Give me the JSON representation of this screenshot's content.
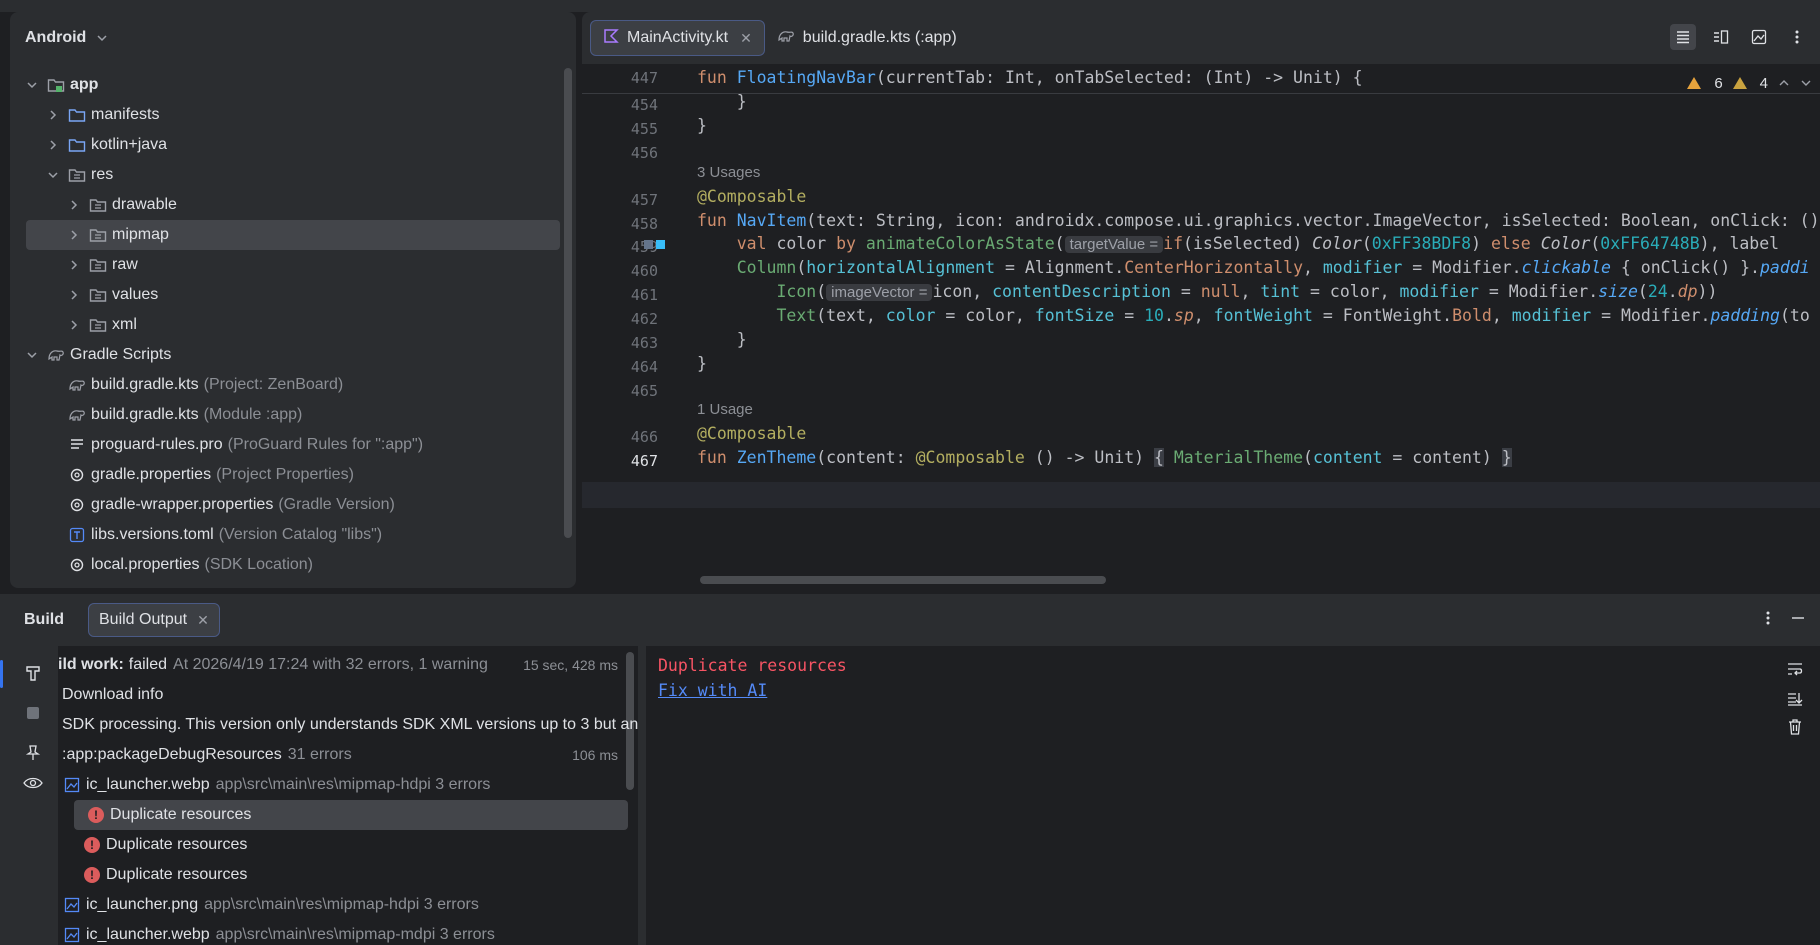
{
  "project": {
    "title": "Android",
    "tree": [
      {
        "label": "app",
        "hint": "",
        "level": 0,
        "toggle": "expanded",
        "icon": "module-folder-icon",
        "bold": true,
        "selected": false
      },
      {
        "label": "manifests",
        "hint": "",
        "level": 1,
        "toggle": "collapsed",
        "icon": "folder-icon",
        "bold": false,
        "selected": false
      },
      {
        "label": "kotlin+java",
        "hint": "",
        "level": 1,
        "toggle": "collapsed",
        "icon": "folder-icon",
        "bold": false,
        "selected": false
      },
      {
        "label": "res",
        "hint": "",
        "level": 1,
        "toggle": "expanded",
        "icon": "resource-folder-icon",
        "bold": false,
        "selected": false
      },
      {
        "label": "drawable",
        "hint": "",
        "level": 2,
        "toggle": "collapsed",
        "icon": "resource-folder-icon",
        "bold": false,
        "selected": false
      },
      {
        "label": "mipmap",
        "hint": "",
        "level": 2,
        "toggle": "collapsed",
        "icon": "resource-folder-icon",
        "bold": false,
        "selected": true
      },
      {
        "label": "raw",
        "hint": "",
        "level": 2,
        "toggle": "collapsed",
        "icon": "resource-folder-icon",
        "bold": false,
        "selected": false
      },
      {
        "label": "values",
        "hint": "",
        "level": 2,
        "toggle": "collapsed",
        "icon": "resource-folder-icon",
        "bold": false,
        "selected": false
      },
      {
        "label": "xml",
        "hint": "",
        "level": 2,
        "toggle": "collapsed",
        "icon": "resource-folder-icon",
        "bold": false,
        "selected": false
      },
      {
        "label": "Gradle Scripts",
        "hint": "",
        "level": 0,
        "toggle": "expanded",
        "icon": "gradle-icon",
        "bold": false,
        "selected": false
      },
      {
        "label": "build.gradle.kts",
        "hint": "(Project: ZenBoard)",
        "level": 1,
        "toggle": "none",
        "icon": "gradle-icon",
        "bold": false,
        "selected": false
      },
      {
        "label": "build.gradle.kts",
        "hint": "(Module :app)",
        "level": 1,
        "toggle": "none",
        "icon": "gradle-icon",
        "bold": false,
        "selected": false
      },
      {
        "label": "proguard-rules.pro",
        "hint": "(ProGuard Rules for \":app\")",
        "level": 1,
        "toggle": "none",
        "icon": "text-file-icon",
        "bold": false,
        "selected": false
      },
      {
        "label": "gradle.properties",
        "hint": "(Project Properties)",
        "level": 1,
        "toggle": "none",
        "icon": "settings-file-icon",
        "bold": false,
        "selected": false
      },
      {
        "label": "gradle-wrapper.properties",
        "hint": "(Gradle Version)",
        "level": 1,
        "toggle": "none",
        "icon": "settings-file-icon",
        "bold": false,
        "selected": false
      },
      {
        "label": "libs.versions.toml",
        "hint": "(Version Catalog \"libs\")",
        "level": 1,
        "toggle": "none",
        "icon": "toml-file-icon",
        "bold": false,
        "selected": false
      },
      {
        "label": "local.properties",
        "hint": "(SDK Location)",
        "level": 1,
        "toggle": "none",
        "icon": "settings-file-icon",
        "bold": false,
        "selected": false
      }
    ]
  },
  "editor": {
    "tabs": [
      {
        "label": "MainActivity.kt",
        "active": true,
        "closable": true,
        "icon": "kotlin-file-icon"
      },
      {
        "label": "build.gradle.kts (:app)",
        "active": false,
        "closable": false,
        "icon": "gradle-icon"
      }
    ],
    "warnings": {
      "errors_label": "6",
      "warnings_label": "4"
    },
    "sticky": {
      "num": "447"
    },
    "lines": [
      {
        "num": "454"
      },
      {
        "num": "455"
      },
      {
        "num": "456"
      },
      {
        "num": ""
      },
      {
        "num": "457"
      },
      {
        "num": "458"
      },
      {
        "num": "459"
      },
      {
        "num": "460"
      },
      {
        "num": "461"
      },
      {
        "num": "462"
      },
      {
        "num": "463"
      },
      {
        "num": "464"
      },
      {
        "num": "465"
      },
      {
        "num": ""
      },
      {
        "num": "466"
      },
      {
        "num": "467"
      }
    ],
    "code": {
      "sticky": [
        "fun",
        "FloatingNavBar",
        "(currentTab: Int, onTabSelected: (Int) -> Unit) {"
      ],
      "l454": "}",
      "l455": "}",
      "usages3": "3 Usages",
      "l457": "@Composable",
      "l458": [
        "fun",
        "NavItem",
        "(text: String, icon: androidx.compose.ui.graphics.vector.ImageVector, isSelected: Boolean, onClick: ()"
      ],
      "l459": [
        "val",
        " color ",
        "by",
        " ",
        "animateColorAsState",
        "(",
        "targetValue =",
        "if",
        "(isSelected) ",
        "Color",
        "(",
        "0xFF38BDF8",
        ") ",
        "else",
        " ",
        "Color",
        "(",
        "0xFF64748B",
        "), label"
      ],
      "l460": [
        "Column",
        "(",
        "horizontalAlignment",
        " = Alignment.",
        "CenterHorizontally",
        ", ",
        "modifier",
        " = Modifier.",
        "clickable",
        " { onClick() }.",
        "paddi"
      ],
      "l461": [
        "Icon",
        "(",
        "imageVector =",
        "icon, ",
        "contentDescription",
        " = ",
        "null",
        ", ",
        "tint",
        " = color, ",
        "modifier",
        " = Modifier.",
        "size",
        "(",
        "24",
        ".",
        "dp",
        "))"
      ],
      "l462": [
        "Text",
        "(text, ",
        "color",
        " = color, ",
        "fontSize",
        " = ",
        "10",
        ".",
        "sp",
        ", ",
        "fontWeight",
        " = FontWeight.",
        "Bold",
        ", ",
        "modifier",
        " = Modifier.",
        "padding",
        "(to"
      ],
      "l463": "}",
      "l464": "}",
      "usages1": "1 Usage",
      "l466": "@Composable",
      "l467": [
        "fun",
        "ZenTheme",
        "(content: ",
        "@Composable",
        " () -> Unit) ",
        "{",
        " ",
        "MaterialTheme",
        "(",
        "content",
        " = content) ",
        "}"
      ]
    }
  },
  "build": {
    "title": "Build",
    "tab_label": "Build Output",
    "rows": [
      {
        "text": "ild work:",
        "rest": "failed",
        "muted": "At 2026/4/19 17:24 with 32 errors, 1 warning",
        "time": "15 sec, 428 ms"
      },
      {
        "text": "Download info"
      },
      {
        "text": "SDK processing. This version only understands SDK XML versions up to 3 but an"
      },
      {
        "text": ":app:packageDebugResources",
        "muted": "31 errors",
        "time": "106 ms"
      },
      {
        "text": "ic_launcher.webp",
        "muted": "app\\src\\main\\res\\mipmap-hdpi 3 errors"
      },
      {
        "text": "Duplicate resources"
      },
      {
        "text": "Duplicate resources"
      },
      {
        "text": "Duplicate resources"
      },
      {
        "text": "ic_launcher.png",
        "muted": "app\\src\\main\\res\\mipmap-hdpi 3 errors"
      },
      {
        "text": "ic_launcher.webp",
        "muted": "app\\src\\main\\res\\mipmap-mdpi 3 errors"
      }
    ],
    "output": {
      "error": "Duplicate resources",
      "link": "Fix with AI"
    }
  },
  "colors": {
    "bg": "#1e1f22",
    "panel": "#2b2d30",
    "selection": "#43454a",
    "error": "#db5c5c",
    "link": "#548af7",
    "warning": "#e6a23c"
  }
}
